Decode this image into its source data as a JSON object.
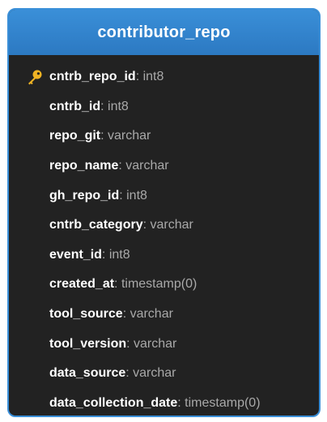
{
  "table": {
    "title": "contributor_repo",
    "fields": [
      {
        "name": "cntrb_repo_id",
        "type": ": int8",
        "primary_key": true
      },
      {
        "name": "cntrb_id",
        "type": ": int8"
      },
      {
        "name": "repo_git",
        "type": ": varchar"
      },
      {
        "name": "repo_name",
        "type": ": varchar"
      },
      {
        "name": "gh_repo_id",
        "type": ": int8"
      },
      {
        "name": "cntrb_category",
        "type": ": varchar"
      },
      {
        "name": "event_id",
        "type": ": int8"
      },
      {
        "name": "created_at",
        "type": ": timestamp(0)"
      },
      {
        "name": "tool_source",
        "type": ": varchar"
      },
      {
        "name": "tool_version",
        "type": ": varchar"
      },
      {
        "name": "data_source",
        "type": ": varchar"
      },
      {
        "name": "data_collection_date",
        "type": ": timestamp(0)"
      }
    ]
  },
  "colors": {
    "header": "#3a8fd8",
    "body": "#222222",
    "field_name": "#ffffff",
    "field_type": "#a9a9a9",
    "key_icon": "#f0b323"
  },
  "icons": {
    "primary_key": "key-icon"
  }
}
